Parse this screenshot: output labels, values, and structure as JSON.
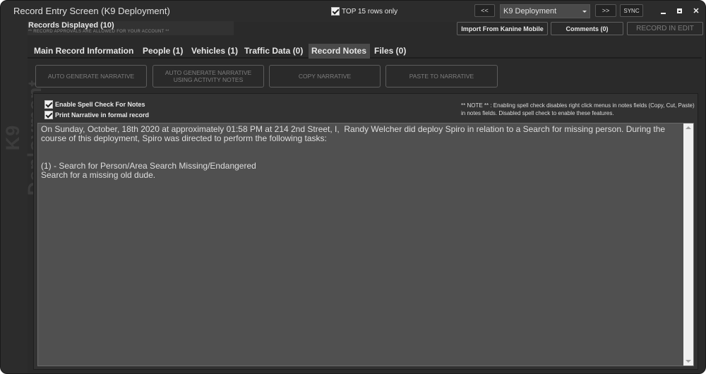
{
  "window": {
    "title": "Record Entry Screen (K9 Deployment)",
    "side_label": "K9 Deployment"
  },
  "toolbar": {
    "top_rows_label": "TOP 15 rows only",
    "top_rows_checked": true,
    "prev_label": "<<",
    "next_label": ">>",
    "record_type_selected": "K9 Deployment",
    "sync_label": "SYNC"
  },
  "records": {
    "title": "Records Displayed (10)",
    "subtitle": "** RECORD APPROVALS ARE ALLOWED FOR YOUR ACCOUNT **"
  },
  "header_buttons": {
    "import_label": "Import From Kanine Mobile",
    "comments_label": "Comments (0)",
    "record_status_label": "RECORD IN EDIT"
  },
  "tabs": [
    {
      "label": "Main Record Information",
      "active": false
    },
    {
      "label": "People (1)",
      "active": false
    },
    {
      "label": "Vehicles (1)",
      "active": false
    },
    {
      "label": "Traffic Data (0)",
      "active": false
    },
    {
      "label": "Record Notes",
      "active": true
    },
    {
      "label": "Files (0)",
      "active": false
    }
  ],
  "actions": {
    "auto_generate": "AUTO GENERATE NARRATIVE",
    "auto_generate_activity": "AUTO GENERATE NARRATIVE USING ACTIVITY NOTES",
    "copy": "COPY NARRATIVE",
    "paste": "PASTE TO NARRATIVE"
  },
  "options": {
    "spell_check_label": "Enable Spell Check For Notes",
    "spell_check_checked": true,
    "formal_record_label": "Print Narrative in formal record",
    "formal_record_checked": true
  },
  "note_text": "** NOTE ** : Enabling spell check disables right click menus in notes fields (Copy, Cut,  Paste) in notes fields. Disabled spell check to enable these features.",
  "narrative": "On Sunday, October, 18th 2020 at approximately 01:58 PM at 214 2nd Street, I,  Randy Welcher did deploy Spiro in relation to a Search for missing person. During the course of this deployment, Spiro was directed to perform the following tasks:\n\n\n(1) - Search for Person/Area Search Missing/Endangered\nSearch for a missing old dude.",
  "colors": {
    "background": "#2a2a2a",
    "panel": "#323232",
    "textarea": "#505050",
    "active_tab": "#4a4a4a"
  }
}
